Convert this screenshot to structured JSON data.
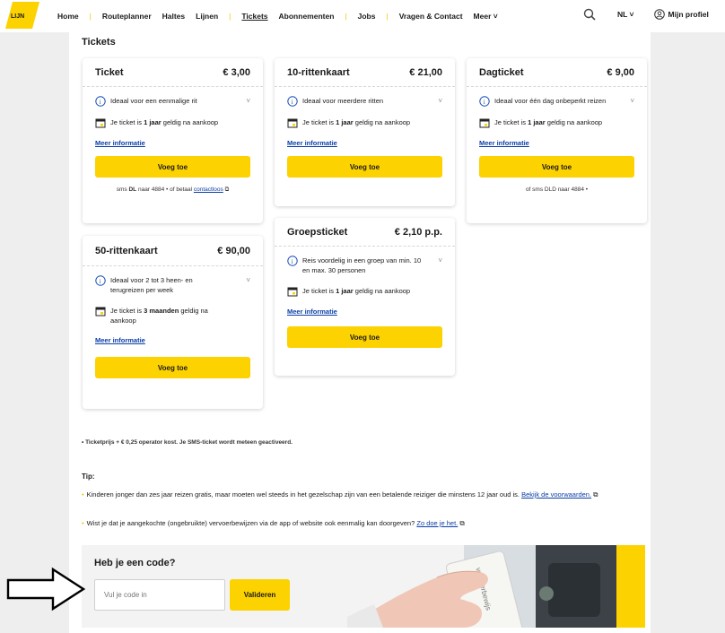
{
  "nav": {
    "items": [
      "Home",
      "Routeplanner",
      "Haltes",
      "Lijnen",
      "Tickets",
      "Abonnementen",
      "Jobs",
      "Vragen & Contact",
      "Meer ˅"
    ],
    "language": "NL ˅",
    "profile": "Mijn profiel"
  },
  "page": {
    "section_title": "Tickets"
  },
  "cards": {
    "ticket": {
      "name": "Ticket",
      "price": "€ 3,00",
      "info": "Ideaal voor een eenmalige rit",
      "validity_pre": "Je ticket is ",
      "validity_bold": "1 jaar",
      "validity_post": " geldig na aankoop",
      "link": "Meer informatie",
      "button": "Voeg toe",
      "note_pre": "sms ",
      "note_bold": "DL",
      "note_mid": " naar 4884 • of betaal ",
      "note_link": "contactloos"
    },
    "tenride": {
      "name": "10-rittenkaart",
      "price": "€ 21,00",
      "info": "Ideaal voor meerdere ritten",
      "validity_pre": "Je ticket is ",
      "validity_bold": "1 jaar",
      "validity_post": " geldig na aankoop",
      "link": "Meer informatie",
      "button": "Voeg toe"
    },
    "day": {
      "name": "Dagticket",
      "price": "€ 9,00",
      "info": "Ideaal voor één dag onbeperkt reizen",
      "validity_pre": "Je ticket is ",
      "validity_bold": "1 jaar",
      "validity_post": " geldig na aankoop",
      "link": "Meer informatie",
      "button": "Voeg toe",
      "note": "of sms DLD naar 4884 •"
    },
    "fifty": {
      "name": "50-rittenkaart",
      "price": "€ 90,00",
      "info": "Ideaal voor 2 tot 3 heen- en terugreizen per week",
      "validity_pre": "Je ticket is ",
      "validity_bold": "3 maanden",
      "validity_post": " geldig na aankoop",
      "link": "Meer informatie",
      "button": "Voeg toe"
    },
    "group": {
      "name": "Groepsticket",
      "price": "€ 2,10 p.p.",
      "info": "Reis voordelig in een groep van min. 10 en max. 30 personen",
      "validity_pre": "Je ticket is ",
      "validity_bold": "1 jaar",
      "validity_post": " geldig na aankoop",
      "link": "Meer informatie",
      "button": "Voeg toe"
    }
  },
  "footnote": "• Ticketprijs + € 0,25 operator kost. Je SMS-ticket wordt meteen geactiveerd.",
  "tips": {
    "title": "Tip:",
    "tip1_text": "Kinderen jonger dan zes jaar reizen gratis, maar moeten wel steeds in het gezelschap zijn van een betalende reiziger die minstens 12 jaar oud is. ",
    "tip1_link": "Bekijk de voorwaarden.",
    "tip2_text": "Wist je dat je aangekochte (ongebruikte) vervoerbewijzen via de app of website ook eenmalig kan doorgeven? ",
    "tip2_link": "Zo doe je het."
  },
  "code": {
    "title": "Heb je een code?",
    "placeholder": "Vul je code in",
    "button": "Valideren",
    "photo_card_text": "vervoerbewijs"
  }
}
